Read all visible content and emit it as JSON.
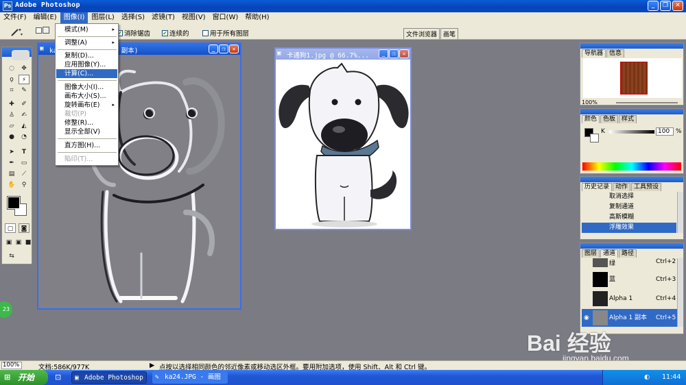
{
  "app": {
    "title": "Adobe Photoshop",
    "logo": "Ps"
  },
  "menubar": [
    "文件(F)",
    "编辑(E)",
    "图像(I)",
    "图层(L)",
    "选择(S)",
    "滤镜(T)",
    "视图(V)",
    "窗口(W)",
    "帮助(H)"
  ],
  "options": {
    "anti_alias": "消除锯齿",
    "contiguous": "连续的",
    "all_layers": "用于所有图层"
  },
  "palette_well": [
    "文件浏览器",
    "画笔"
  ],
  "image_menu": {
    "items": [
      {
        "label": "模式(M)",
        "arrow": "▸"
      },
      {
        "label": "调整(A)",
        "arrow": "▸"
      },
      {
        "label": "复制(D)..."
      },
      {
        "label": "应用图像(Y)..."
      },
      {
        "label": "计算(C)..."
      },
      {
        "label": "图像大小(I)..."
      },
      {
        "label": "画布大小(S)..."
      },
      {
        "label": "旋转画布(E)",
        "arrow": "▸"
      },
      {
        "label": "裁切(P)",
        "disabled": true
      },
      {
        "label": "修整(R)..."
      },
      {
        "label": "显示全部(V)"
      },
      {
        "label": "直方图(H)..."
      },
      {
        "label": "陷印(T)...",
        "disabled": true
      }
    ]
  },
  "doc_left": {
    "title": "ka(图层 1, Alpha 1 副本)"
  },
  "doc_right": {
    "title": "卡通狗1.jpg @ 66.7%..."
  },
  "navigator": {
    "tabs": [
      "导航器",
      "信息"
    ],
    "zoom": "100%"
  },
  "color": {
    "tabs": [
      "颜色",
      "色板",
      "样式"
    ],
    "channel": "K",
    "value": "100",
    "unit": "%"
  },
  "history": {
    "tabs": [
      "历史记录",
      "动作",
      "工具预设"
    ],
    "items": [
      "取消选择",
      "复制通道",
      "高斯模糊",
      "浮雕效果"
    ]
  },
  "channels": {
    "tabs": [
      "图层",
      "通道",
      "路径"
    ],
    "items": [
      {
        "name": "绿",
        "key": "Ctrl+2"
      },
      {
        "name": "蓝",
        "key": "Ctrl+3"
      },
      {
        "name": "Alpha 1",
        "key": "Ctrl+4"
      },
      {
        "name": "Alpha 1 副本",
        "key": "Ctrl+5"
      }
    ]
  },
  "status": {
    "zoom": "100%",
    "doc": "文档:586K/977K",
    "hint": "点按以选择相同颜色的邻近像素或移动选区外框。要用附加选项，使用 Shift、Alt 和 Ctrl 键。"
  },
  "taskbar": {
    "start": "开始",
    "tasks": [
      "Adobe Photoshop",
      "ka24.JPG - 画图"
    ],
    "clock": "11:44"
  },
  "watermark": {
    "text": "Bai 经验",
    "url": "jingyan.baidu.com"
  },
  "badge": "23"
}
